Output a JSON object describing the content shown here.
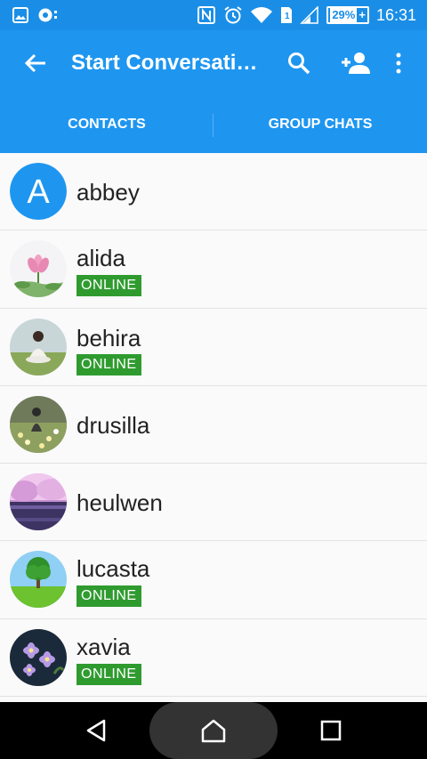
{
  "statusbar": {
    "time": "16:31",
    "battery_level": "29%",
    "icons": [
      "image-icon",
      "record-icon",
      "nfc-icon",
      "alarm-icon",
      "wifi-icon",
      "sim-icon",
      "signal-icon",
      "battery-icon"
    ]
  },
  "appbar": {
    "title": "Start Conversati…",
    "actions": [
      "back-arrow-icon",
      "search-icon",
      "add-person-icon",
      "more-vert-icon"
    ]
  },
  "tabs": [
    {
      "label": "CONTACTS"
    },
    {
      "label": "GROUP CHATS"
    }
  ],
  "contacts": [
    {
      "name": "abbey",
      "avatar_letter": "A",
      "online_label": ""
    },
    {
      "name": "alida",
      "avatar_letter": "",
      "online_label": "ONLINE"
    },
    {
      "name": "behira",
      "avatar_letter": "",
      "online_label": "ONLINE"
    },
    {
      "name": "drusilla",
      "avatar_letter": "",
      "online_label": ""
    },
    {
      "name": "heulwen",
      "avatar_letter": "",
      "online_label": ""
    },
    {
      "name": "lucasta",
      "avatar_letter": "",
      "online_label": "ONLINE"
    },
    {
      "name": "xavia",
      "avatar_letter": "",
      "online_label": "ONLINE"
    }
  ],
  "colors": {
    "accent": "#1e96f0",
    "statusbar": "#1a8ee6",
    "online_badge": "#2f9b2f"
  },
  "navbar": {
    "icons": [
      "back-triangle-icon",
      "home-icon",
      "recents-square-icon"
    ]
  }
}
